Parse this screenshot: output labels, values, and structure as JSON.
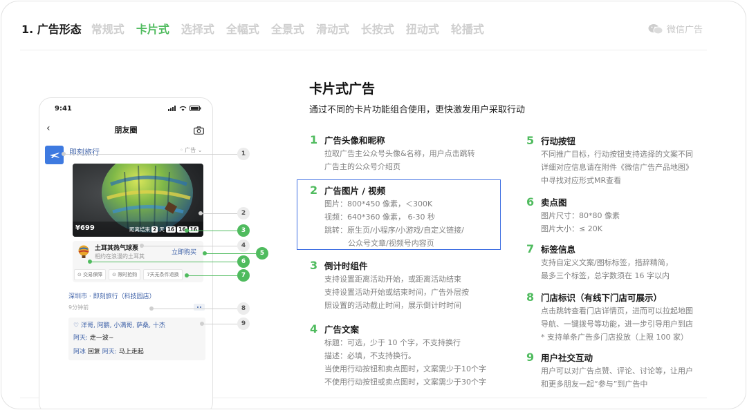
{
  "nav": {
    "title": "1. 广告形态",
    "tabs": [
      "常规式",
      "卡片式",
      "选择式",
      "全幅式",
      "全景式",
      "滑动式",
      "长按式",
      "扭动式",
      "轮播式"
    ],
    "active_tab": "卡片式",
    "brand": "微信广告"
  },
  "phone": {
    "time": "9:41",
    "nav_title": "朋友圈",
    "nickname": "即刻旅行",
    "ad_tag": "广告",
    "price": "¥699",
    "countdown_label": "距离结束",
    "countdown_days": "2",
    "countdown_day_unit": "天",
    "countdown_h": "16",
    "countdown_m": "16",
    "countdown_s": "16",
    "product_name": "土耳其热气球票",
    "product_sub": "相约在浪漫的土耳其",
    "buy_label": "立即购买",
    "tags": [
      "交易保障",
      "限时抢购",
      "7天无条件退换"
    ],
    "store": "深圳市 · 即刻旅行（科技园店）",
    "time_ago": "9分钟前",
    "likes": "洋哥, 阿鹏, 小满哥, 萨桑, 十杰",
    "comment1_user": "阿天:",
    "comment1_text": "走一波~",
    "comment2_user": "阿冰",
    "comment2_reply": "回复",
    "comment2_target": "阿天:",
    "comment2_text": "马上走起"
  },
  "callouts": [
    "1",
    "2",
    "3",
    "4",
    "5",
    "6",
    "7",
    "8",
    "9"
  ],
  "content": {
    "title": "卡片式广告",
    "subtitle": "通过不同的卡片功能组合使用，更快激发用户采取行动",
    "items": [
      {
        "num": "1",
        "title": "广告头像和昵称",
        "lines": [
          "拉取广告主公众号头像&名称，用户点击跳转",
          "广告主的公众号介绍页"
        ]
      },
      {
        "num": "2",
        "title": "广告图片 / 视频",
        "lines": [
          "图片：800*450 像素，＜300K",
          "视频：640*360 像素，  6-30 秒",
          "跳转：原生页/小程序/小游戏/自定义链接/",
          "          公众号文章/视频号内容页"
        ]
      },
      {
        "num": "3",
        "title": "倒计时组件",
        "lines": [
          "支持设置距离活动开始，或距离活动结束",
          "支持设置活动开始或结束时间，广告外层按",
          "照设置的活动截止时间，展示倒计时时间"
        ]
      },
      {
        "num": "4",
        "title": "广告文案",
        "lines": [
          "标题：可选，少于 10 个字，不支持换行",
          "描述：必填，不支持换行。",
          "当使用行动按钮和卖点图时，文案需少于10个字",
          "不使用行动按钮或卖点图时，文案需少于30个字"
        ]
      },
      {
        "num": "5",
        "title": "行动按钮",
        "lines": [
          "不同推广目标，行动按钮支持选择的文案不同",
          "详细对应信息请在附件《微信广告产品地图》",
          "中寻找对应形式MR查看"
        ]
      },
      {
        "num": "6",
        "title": "卖点图",
        "lines": [
          "图片尺寸：80*80 像素",
          "图片大小：≤ 20K"
        ]
      },
      {
        "num": "7",
        "title": "标签信息",
        "lines": [
          "支持自定义文案/图标标签，措辞精简，",
          "最多三个标签，总字数须在 16 字以内"
        ]
      },
      {
        "num": "8",
        "title": "门店标识（有线下门店可展示）",
        "lines": [
          "点击跳转查看门店详情页，进而可以拉起地图",
          "导航、一键拨号等功能，进一步引导用户到店",
          "* 支持单条广告多门店投放（上限 100 家）"
        ]
      },
      {
        "num": "9",
        "title": "用户社交互动",
        "lines": [
          "用户可以对广告点赞、评论、讨论等，让用户",
          "和更多朋友一起“参与”到广告中"
        ]
      }
    ]
  },
  "colors": {
    "accent": "#4fbb5e",
    "link": "#3f62a8",
    "highlight": "#3c6de2"
  }
}
